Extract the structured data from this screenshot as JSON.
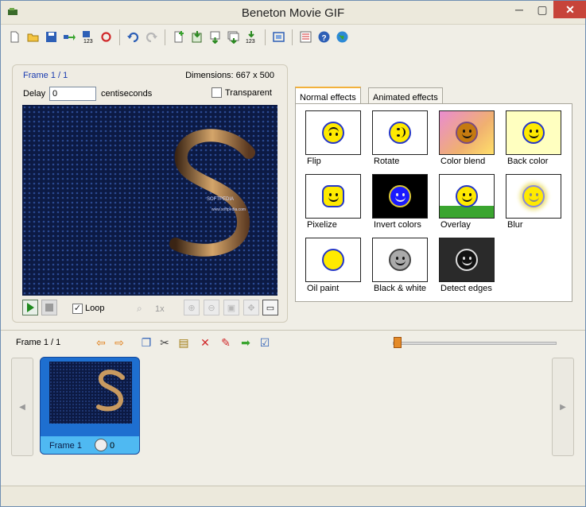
{
  "window": {
    "title": "Beneton Movie GIF",
    "min": "─",
    "max": "▢",
    "close": "✕"
  },
  "toolbar": {
    "buttons": [
      "new-icon",
      "open-icon",
      "save-icon",
      "export-icon",
      "save-numbered-icon",
      "refresh-icon",
      "undo-icon",
      "redo-icon",
      "insert-frame-icon",
      "import-image-icon",
      "add-frame-icon",
      "add-frames-icon",
      "number-frames-icon",
      "fit-icon",
      "properties-icon",
      "help-icon",
      "web-icon"
    ]
  },
  "frame_panel": {
    "frame_label": "Frame 1 / 1",
    "dimensions": "Dimensions: 667 x 500",
    "delay_label": "Delay",
    "delay_value": "0",
    "delay_unit": "centiseconds",
    "transparent_label": "Transparent",
    "transparent_checked": false,
    "loop_label": "Loop",
    "loop_checked": true,
    "zoom_text": "1x"
  },
  "effects": {
    "tabs": [
      {
        "label": "Normal effects",
        "active": true
      },
      {
        "label": "Animated effects",
        "active": false
      }
    ],
    "items": [
      {
        "label": "Flip",
        "icon": "smiley-flip"
      },
      {
        "label": "Rotate",
        "icon": "smiley-rotate"
      },
      {
        "label": "Color blend",
        "icon": "smiley-colorblend"
      },
      {
        "label": "Back color",
        "icon": "smiley-backcolor"
      },
      {
        "label": "Pixelize",
        "icon": "smiley-pixelize"
      },
      {
        "label": "Invert colors",
        "icon": "smiley-invert"
      },
      {
        "label": "Overlay",
        "icon": "smiley-overlay"
      },
      {
        "label": "Blur",
        "icon": "smiley-blur"
      },
      {
        "label": "Oil paint",
        "icon": "smiley-oilpaint"
      },
      {
        "label": "Black & white",
        "icon": "smiley-bw"
      },
      {
        "label": "Detect edges",
        "icon": "smiley-edges"
      }
    ]
  },
  "filmstrip": {
    "frame_label": "Frame 1 / 1",
    "card_name": "Frame 1",
    "card_delay": "0",
    "slider_value": 0
  },
  "preview": {
    "line1": "SOFTPEDIA",
    "line2": "www.softpedia.com"
  },
  "colors": {
    "accent_tab": "#f2b13c",
    "card": "#1e6fd0",
    "card_footer": "#4fb9f2",
    "frame_label": "#1a3bb0",
    "close": "#c7443a"
  }
}
